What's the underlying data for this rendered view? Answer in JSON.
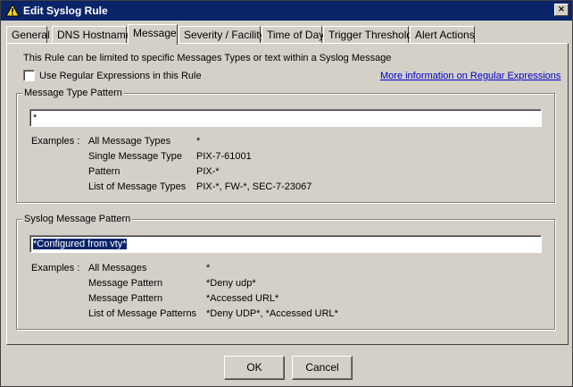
{
  "window": {
    "title": "Edit Syslog Rule",
    "close_symbol": "×"
  },
  "tabs": [
    {
      "label": "General"
    },
    {
      "label": "DNS Hostname"
    },
    {
      "label": "Message"
    },
    {
      "label": "Severity / Facility"
    },
    {
      "label": "Time of Day"
    },
    {
      "label": "Trigger Threshold"
    },
    {
      "label": "Alert Actions"
    }
  ],
  "message_tab": {
    "intro": "This Rule can be limited to specific Messages Types or text within a Syslog Message",
    "regex_checkbox_label": "Use Regular Expressions in this Rule",
    "regex_checked": false,
    "regex_link": "More information on Regular Expressions",
    "type_group": {
      "title": "Message Type Pattern",
      "value": "*",
      "examples_label": "Examples :",
      "examples": [
        {
          "name": "All Message Types",
          "value": "*"
        },
        {
          "name": "Single Message Type",
          "value": "PIX-7-61001"
        },
        {
          "name": "Pattern",
          "value": "PIX-*"
        },
        {
          "name": "List of Message Types",
          "value": "PIX-*, FW-*, SEC-7-23067"
        }
      ]
    },
    "syslog_group": {
      "title": "Syslog Message Pattern",
      "value": "*Configured from vty*",
      "examples_label": "Examples :",
      "examples": [
        {
          "name": "All Messages",
          "value": "*"
        },
        {
          "name": "Message Pattern",
          "value": "*Deny udp*"
        },
        {
          "name": "Message Pattern",
          "value": "*Accessed URL*"
        },
        {
          "name": "List of Message Patterns",
          "value": "*Deny UDP*, *Accessed URL*"
        }
      ]
    }
  },
  "buttons": {
    "ok": "OK",
    "cancel": "Cancel"
  }
}
